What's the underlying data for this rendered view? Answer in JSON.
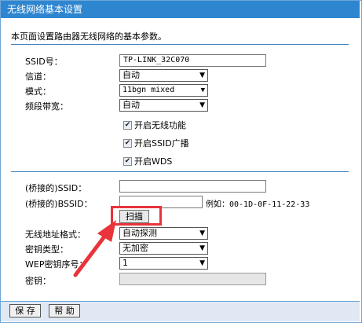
{
  "window": {
    "title": "无线网络基本设置"
  },
  "description": "本页面设置路由器无线网络的基本参数。",
  "fields": {
    "ssid_label": "SSID号：",
    "ssid_value": "TP-LINK_32C070",
    "channel_label": "信道：",
    "channel_value": "自动",
    "mode_label": "模式：",
    "mode_value": "11bgn mixed",
    "bandwidth_label": "频段带宽：",
    "bandwidth_value": "自动"
  },
  "checkboxes": [
    {
      "label": "开启无线功能",
      "checked": true
    },
    {
      "label": "开启SSID广播",
      "checked": true
    },
    {
      "label": "开启WDS",
      "checked": true
    }
  ],
  "wds": {
    "bridged_ssid_label": "(桥接的)SSID：",
    "bridged_ssid_value": "",
    "bridged_bssid_label": "(桥接的)BSSID：",
    "bridged_bssid_value": "",
    "bssid_example": "例如：00-1D-0F-11-22-33",
    "scan_button": "扫描",
    "address_format_label": "无线地址格式：",
    "address_format_value": "自动探测",
    "key_type_label": "密钥类型：",
    "key_type_value": "无加密",
    "wep_index_label": "WEP密钥序号：",
    "wep_index_value": "1",
    "key_label": "密钥：",
    "key_value": ""
  },
  "footer": {
    "save": "保 存",
    "help": "帮 助"
  },
  "colors": {
    "titlebar": "#2f86d0",
    "highlight": "#e8343a",
    "divider": "#3a7fc1"
  },
  "icons": {
    "dropdown": "chevron-down-icon",
    "check": "checkmark-icon"
  }
}
